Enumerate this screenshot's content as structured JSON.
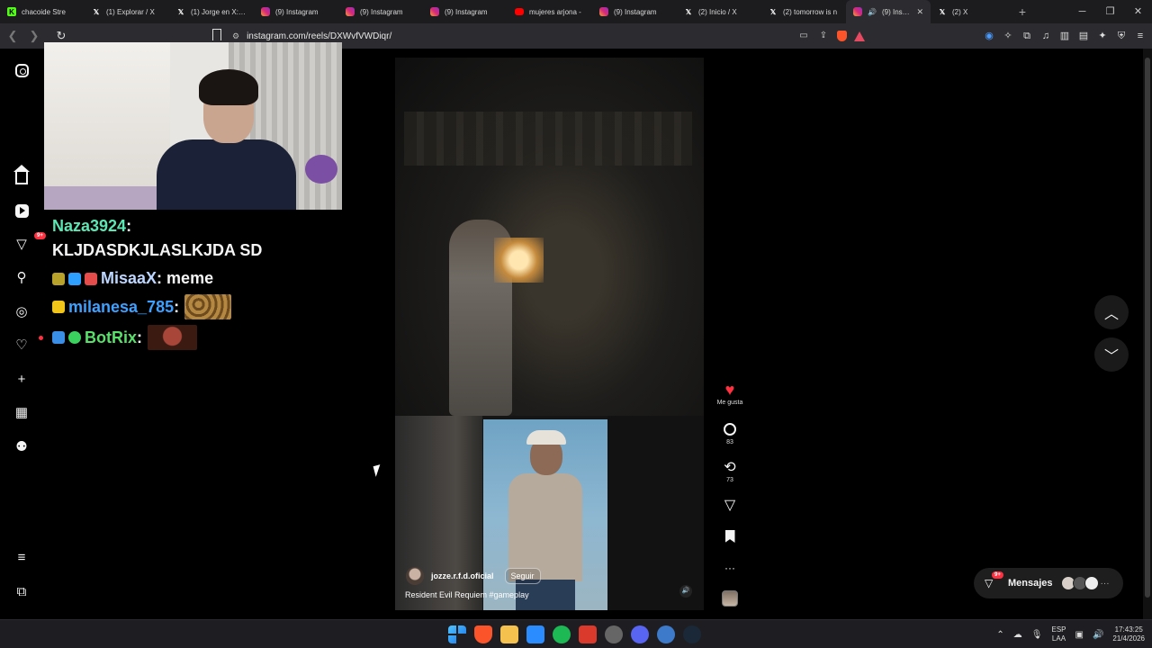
{
  "browser": {
    "tabs": [
      {
        "label": "chacoide Stre",
        "icon": "kick",
        "active": false
      },
      {
        "label": "(1) Explorar / X",
        "icon": "x",
        "active": false
      },
      {
        "label": "(1) Jorge en X: \"E",
        "icon": "x",
        "active": false
      },
      {
        "label": "(9) Instagram",
        "icon": "instagram",
        "active": false
      },
      {
        "label": "(9) Instagram",
        "icon": "instagram",
        "active": false
      },
      {
        "label": "(9) Instagram",
        "icon": "instagram",
        "active": false
      },
      {
        "label": "mujeres arjona -",
        "icon": "youtube",
        "active": false
      },
      {
        "label": "(9) Instagram",
        "icon": "instagram",
        "active": false
      },
      {
        "label": "(2) Inicio / X",
        "icon": "x",
        "active": false
      },
      {
        "label": "(2) tomorrow is n",
        "icon": "x",
        "active": false
      },
      {
        "label": "(9) Instag",
        "icon": "instagram",
        "active": true
      },
      {
        "label": "(2) X",
        "icon": "x",
        "active": false
      }
    ],
    "new_tab": "+",
    "window_controls": {
      "minimize": "─",
      "maximize": "❐",
      "close": "✕"
    },
    "url": "instagram.com/reels/DXWvfVWDiqr/"
  },
  "chat": [
    {
      "user": "Naza3924",
      "message": "KLJDASDKJLASLKJDA SD",
      "color": "#5ce6b3"
    },
    {
      "user": "MisaaX",
      "message": "meme",
      "color": "#bcd6ff"
    },
    {
      "user": "milanesa_785",
      "message": "",
      "color": "#3ea0ff"
    },
    {
      "user": "BotRix",
      "message": "",
      "color": "#59e06a"
    }
  ],
  "nav": {
    "notifications_badge": "9+"
  },
  "reel": {
    "username": "jozze.r.f.d.oficial",
    "follow_label": "Seguir",
    "caption": "Resident Evil Requiem #gameplay"
  },
  "actions": {
    "like_label": "Me gusta",
    "comments": "83",
    "reposts": "73"
  },
  "messages": {
    "label": "Mensajes",
    "badge": "9+",
    "more": "···"
  },
  "taskbar": {
    "lang_top": "ESP",
    "lang_bottom": "LAA",
    "time": "17:43:25",
    "date": "21/4/2026"
  },
  "colors": {
    "like": "#ff3040",
    "instagram_bg": "#000000",
    "badge": "#ff3040"
  }
}
